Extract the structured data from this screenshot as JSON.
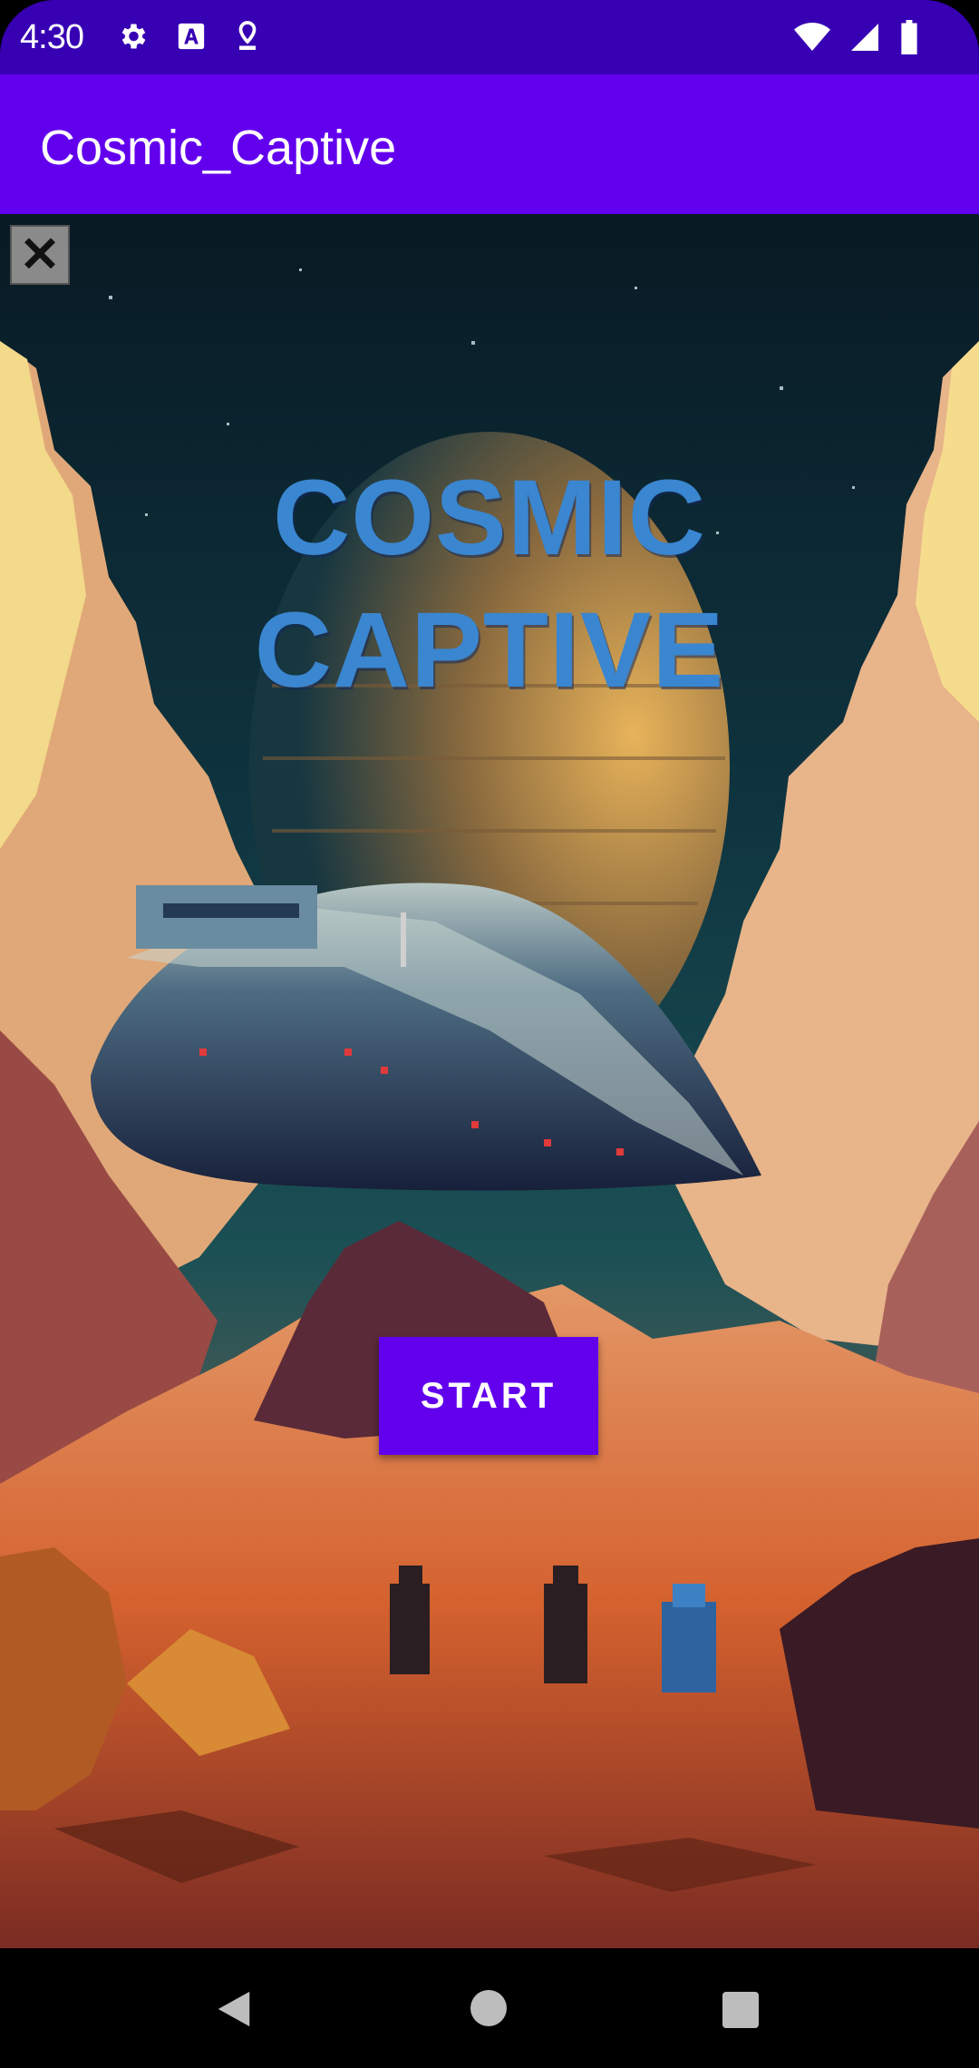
{
  "status_bar": {
    "time": "4:30",
    "left_icons": [
      "settings-gear-icon",
      "font-a-icon",
      "location-pin-icon"
    ],
    "right_icons": [
      "wifi-icon",
      "signal-icon",
      "battery-icon"
    ]
  },
  "app_bar": {
    "title": "Cosmic_Captive"
  },
  "game": {
    "title_line1": "COSMIC",
    "title_line2": "CAPTIVE",
    "close_symbol": "✕",
    "start_label": "START"
  },
  "nav_bar": {
    "icons": [
      "back-triangle-icon",
      "home-circle-icon",
      "recents-square-icon"
    ]
  },
  "colors": {
    "status_bar": "#3700b3",
    "app_bar": "#6200ee",
    "title_text": "#3a86d0",
    "start_button": "#6200ee"
  }
}
